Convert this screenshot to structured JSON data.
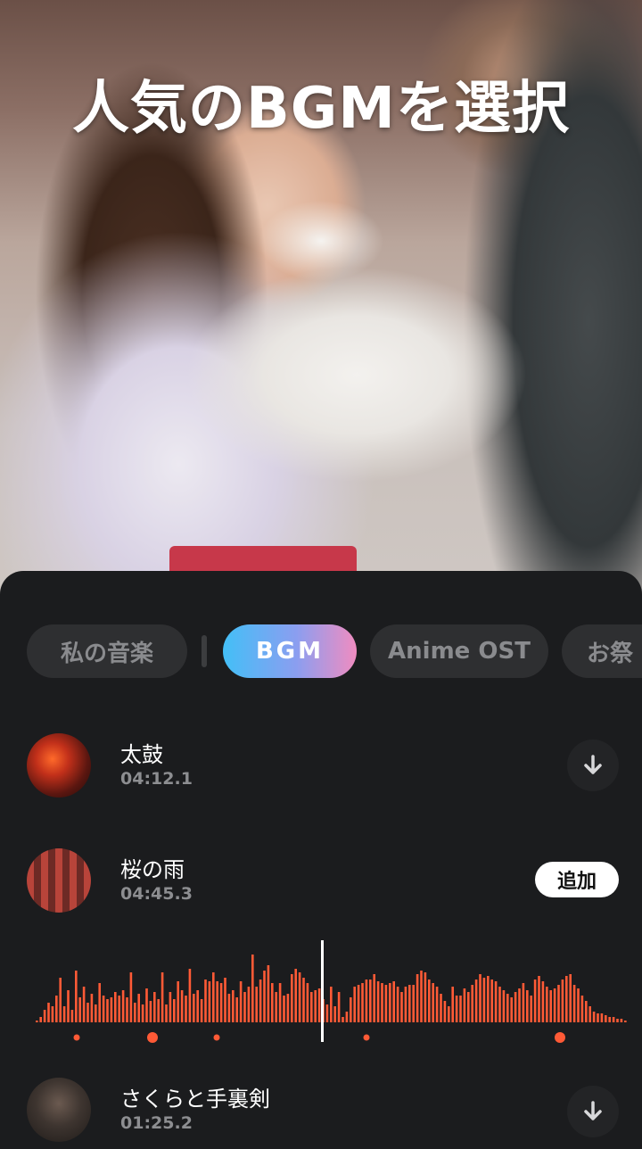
{
  "hero": {
    "title": "人気のBGMを選択"
  },
  "tabs": [
    {
      "label": "私の音楽",
      "active": false
    },
    {
      "label": "BGM",
      "active": true
    },
    {
      "label": "Anime OST",
      "active": false
    },
    {
      "label": "お祭",
      "active": false
    }
  ],
  "tracks": [
    {
      "title": "太鼓",
      "duration": "04:12.1",
      "action": "download-icon"
    },
    {
      "title": "桜の雨",
      "duration": "04:45.3",
      "action_label": "追加"
    },
    {
      "title": "さくらと手裏剣",
      "duration": "01:25.2",
      "action": "download-icon"
    }
  ],
  "waveform": {
    "progress": 0.5,
    "accent": "#ff5a36",
    "playhead_color": "#ffffff"
  },
  "colors": {
    "background": "#1b1c1e",
    "tab_bg": "#2e2f31",
    "active_tab_gradient": [
      "#43bff7",
      "#8b9ef0",
      "#f08cc0"
    ]
  }
}
